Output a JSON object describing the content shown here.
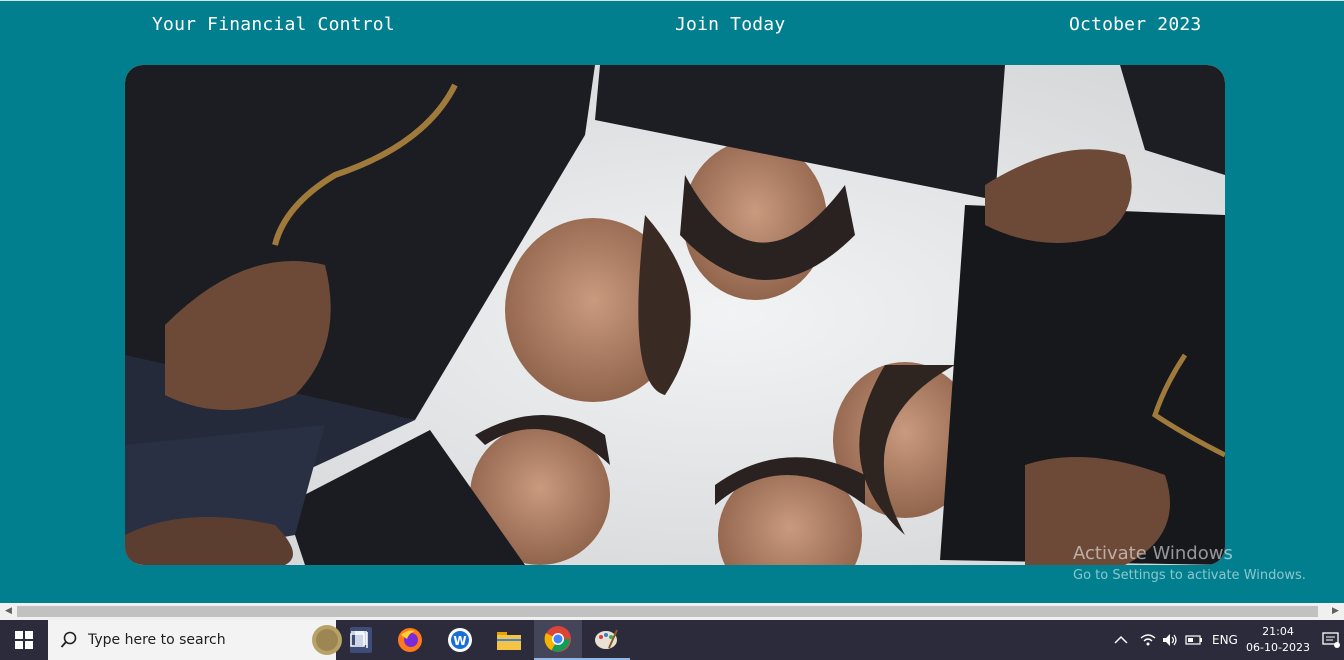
{
  "header": {
    "left": "Your Financial Control",
    "center": "Join Today",
    "right": "October 2023"
  },
  "hero": {
    "alt": "Graduates looking down into the camera holding mortarboard caps"
  },
  "watermark": {
    "title": "Activate Windows",
    "subtitle": "Go to Settings to activate Windows."
  },
  "taskbar": {
    "search_placeholder": "Type here to search",
    "apps": [
      "task-view",
      "firefox",
      "app-w",
      "file-explorer",
      "chrome",
      "paint"
    ],
    "tray": {
      "language": "ENG",
      "time": "21:04",
      "date": "06-10-2023"
    }
  },
  "colors": {
    "page_bg": "#017f8e",
    "taskbar_bg": "#2b2b3c",
    "header_text": "#ffffff"
  }
}
